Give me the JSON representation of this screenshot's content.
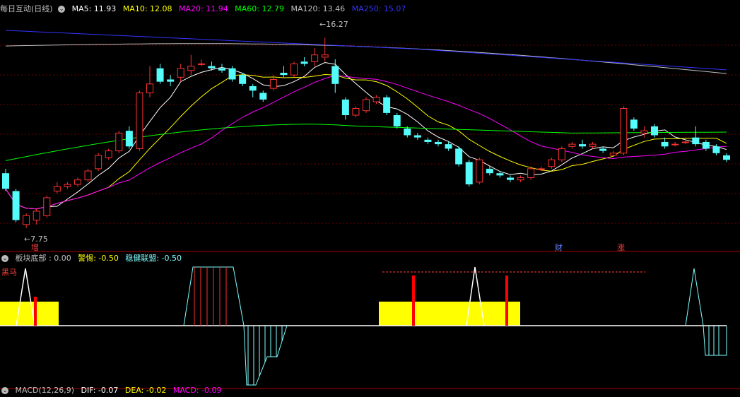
{
  "main_panel": {
    "title": "每日互动(日线)",
    "indicators": [
      {
        "label": "MA5: 11.93",
        "color": "#ffffff"
      },
      {
        "label": "MA10: 12.08",
        "color": "#ffff00"
      },
      {
        "label": "MA20: 11.94",
        "color": "#ff00ff"
      },
      {
        "label": "MA60: 12.79",
        "color": "#00ff00"
      },
      {
        "label": "MA120: 13.46",
        "color": "#c0c0c0"
      },
      {
        "label": "MA250: 15.07",
        "color": "#3333ff"
      }
    ],
    "high_marker": "16.27",
    "low_marker": "7.75",
    "event_tags": [
      "增",
      "财",
      "涨"
    ]
  },
  "sub_panel": {
    "title": "板块底部",
    "items": [
      {
        "label": ": 0.00",
        "color": "#c0c0c0"
      },
      {
        "label": "警惕: -0.50",
        "color": "#ffff00"
      },
      {
        "label": "稳健联盟: -0.50",
        "color": "#80ffff"
      }
    ],
    "tag": "黑马"
  },
  "bottom_panel": {
    "title": "MACD(12,26,9)",
    "items": [
      {
        "label": "DIF: -0.07",
        "color": "#ffffff"
      },
      {
        "label": "DEA: -0.02",
        "color": "#ffff00"
      },
      {
        "label": "MACD: -0.09",
        "color": "#ff00ff"
      }
    ]
  },
  "chart_data": {
    "type": "candlestick",
    "price_range": [
      7.2,
      17.2
    ],
    "candles": [
      [
        10.2,
        9.5,
        10.4,
        9.4
      ],
      [
        9.4,
        8.1,
        9.5,
        8.0
      ],
      [
        7.9,
        8.3,
        8.4,
        7.75
      ],
      [
        8.1,
        8.5,
        8.6,
        7.9
      ],
      [
        8.3,
        9.1,
        9.2,
        8.2
      ],
      [
        9.4,
        9.6,
        9.8,
        9.3
      ],
      [
        9.6,
        9.7,
        9.8,
        9.5
      ],
      [
        9.7,
        9.9,
        10.0,
        9.6
      ],
      [
        9.9,
        10.3,
        10.4,
        9.8
      ],
      [
        10.4,
        11.0,
        11.1,
        10.3
      ],
      [
        10.9,
        11.2,
        11.3,
        10.8
      ],
      [
        11.2,
        12.0,
        12.1,
        11.1
      ],
      [
        12.1,
        11.4,
        12.3,
        11.3
      ],
      [
        11.3,
        13.8,
        13.9,
        11.2
      ],
      [
        13.8,
        14.2,
        15.0,
        13.6
      ],
      [
        14.9,
        14.3,
        15.1,
        14.2
      ],
      [
        14.4,
        14.3,
        14.6,
        14.1
      ],
      [
        14.5,
        14.9,
        15.1,
        14.3
      ],
      [
        14.8,
        15.0,
        15.5,
        14.6
      ],
      [
        15.1,
        15.1,
        15.3,
        15.0
      ],
      [
        15.0,
        14.9,
        15.2,
        14.8
      ],
      [
        14.9,
        14.8,
        15.1,
        14.7
      ],
      [
        14.9,
        14.4,
        15.0,
        14.3
      ],
      [
        14.6,
        14.2,
        14.7,
        14.1
      ],
      [
        14.1,
        13.9,
        14.2,
        13.6
      ],
      [
        13.8,
        13.5,
        13.9,
        13.4
      ],
      [
        14.0,
        14.4,
        14.6,
        13.9
      ],
      [
        14.7,
        14.6,
        15.0,
        14.5
      ],
      [
        14.6,
        15.1,
        15.2,
        14.5
      ],
      [
        15.2,
        15.1,
        15.4,
        15.0
      ],
      [
        15.2,
        15.5,
        15.8,
        15.0
      ],
      [
        15.4,
        15.5,
        16.27,
        15.2
      ],
      [
        15.0,
        14.2,
        15.3,
        13.8
      ],
      [
        13.5,
        12.8,
        13.6,
        12.6
      ],
      [
        12.8,
        13.1,
        13.2,
        12.7
      ],
      [
        13.0,
        13.5,
        13.6,
        12.9
      ],
      [
        13.4,
        13.6,
        13.7,
        13.3
      ],
      [
        13.6,
        12.9,
        13.7,
        12.8
      ],
      [
        12.8,
        12.3,
        12.9,
        12.2
      ],
      [
        12.2,
        11.9,
        12.3,
        11.8
      ],
      [
        11.9,
        11.8,
        12.0,
        11.7
      ],
      [
        11.7,
        11.6,
        11.8,
        11.5
      ],
      [
        11.6,
        11.5,
        11.7,
        11.4
      ],
      [
        11.5,
        11.3,
        11.6,
        11.2
      ],
      [
        11.3,
        10.6,
        11.4,
        10.5
      ],
      [
        10.7,
        9.7,
        10.8,
        9.6
      ],
      [
        9.8,
        10.8,
        10.9,
        9.7
      ],
      [
        10.4,
        10.2,
        10.5,
        10.1
      ],
      [
        10.2,
        10.1,
        10.3,
        10.0
      ],
      [
        10.0,
        9.9,
        10.1,
        9.8
      ],
      [
        9.9,
        10.0,
        10.1,
        9.8
      ],
      [
        10.0,
        10.4,
        10.5,
        9.9
      ],
      [
        10.4,
        10.4,
        10.5,
        10.3
      ],
      [
        10.5,
        10.8,
        10.9,
        10.4
      ],
      [
        10.8,
        11.3,
        11.4,
        10.7
      ],
      [
        11.4,
        11.5,
        11.6,
        11.3
      ],
      [
        11.5,
        11.4,
        11.7,
        11.3
      ],
      [
        11.4,
        11.5,
        11.6,
        11.3
      ],
      [
        11.3,
        11.2,
        11.4,
        11.1
      ],
      [
        11.0,
        11.1,
        11.2,
        11.0
      ],
      [
        11.1,
        13.1,
        13.2,
        11.0
      ],
      [
        12.6,
        12.2,
        12.7,
        12.1
      ],
      [
        12.0,
        12.1,
        12.3,
        11.8
      ],
      [
        12.3,
        11.9,
        12.4,
        11.8
      ],
      [
        11.6,
        11.4,
        11.8,
        11.3
      ],
      [
        11.5,
        11.5,
        11.6,
        11.4
      ],
      [
        11.6,
        11.6,
        11.8,
        11.5
      ],
      [
        11.8,
        11.5,
        12.3,
        11.4
      ],
      [
        11.6,
        11.3,
        11.7,
        11.2
      ],
      [
        11.4,
        11.1,
        11.5,
        11.0
      ],
      [
        11.0,
        10.8,
        11.1,
        10.7
      ]
    ]
  }
}
